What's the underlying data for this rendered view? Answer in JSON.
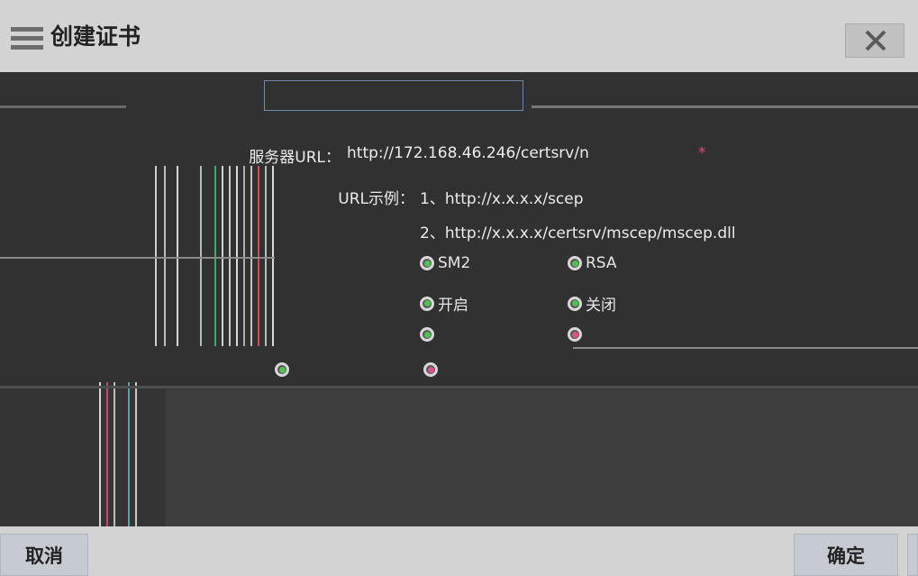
{
  "window": {
    "title": "创建证书"
  },
  "form": {
    "server_url_label": "服务器URL：",
    "server_url_value": "http://172.168.46.246/certsrv/n",
    "required_mark": "*",
    "url_example_label": "URL示例：",
    "url_example_1": "1、http://x.x.x.x/scep",
    "url_example_2": "2、http://x.x.x.x/certsrv/mscep/mscep.dll",
    "option_row_1": {
      "option_a": "SM2",
      "option_b": "RSA"
    },
    "option_row_2": {
      "option_a": "开启",
      "option_b": "关闭"
    }
  },
  "buttons": {
    "cancel": "取消",
    "confirm": "确定"
  },
  "colors": {
    "radio_green": "#4fc24f",
    "radio_pink": "#e0508a",
    "panel_bg": "#313131",
    "bar_bg": "#d3d3d3"
  }
}
